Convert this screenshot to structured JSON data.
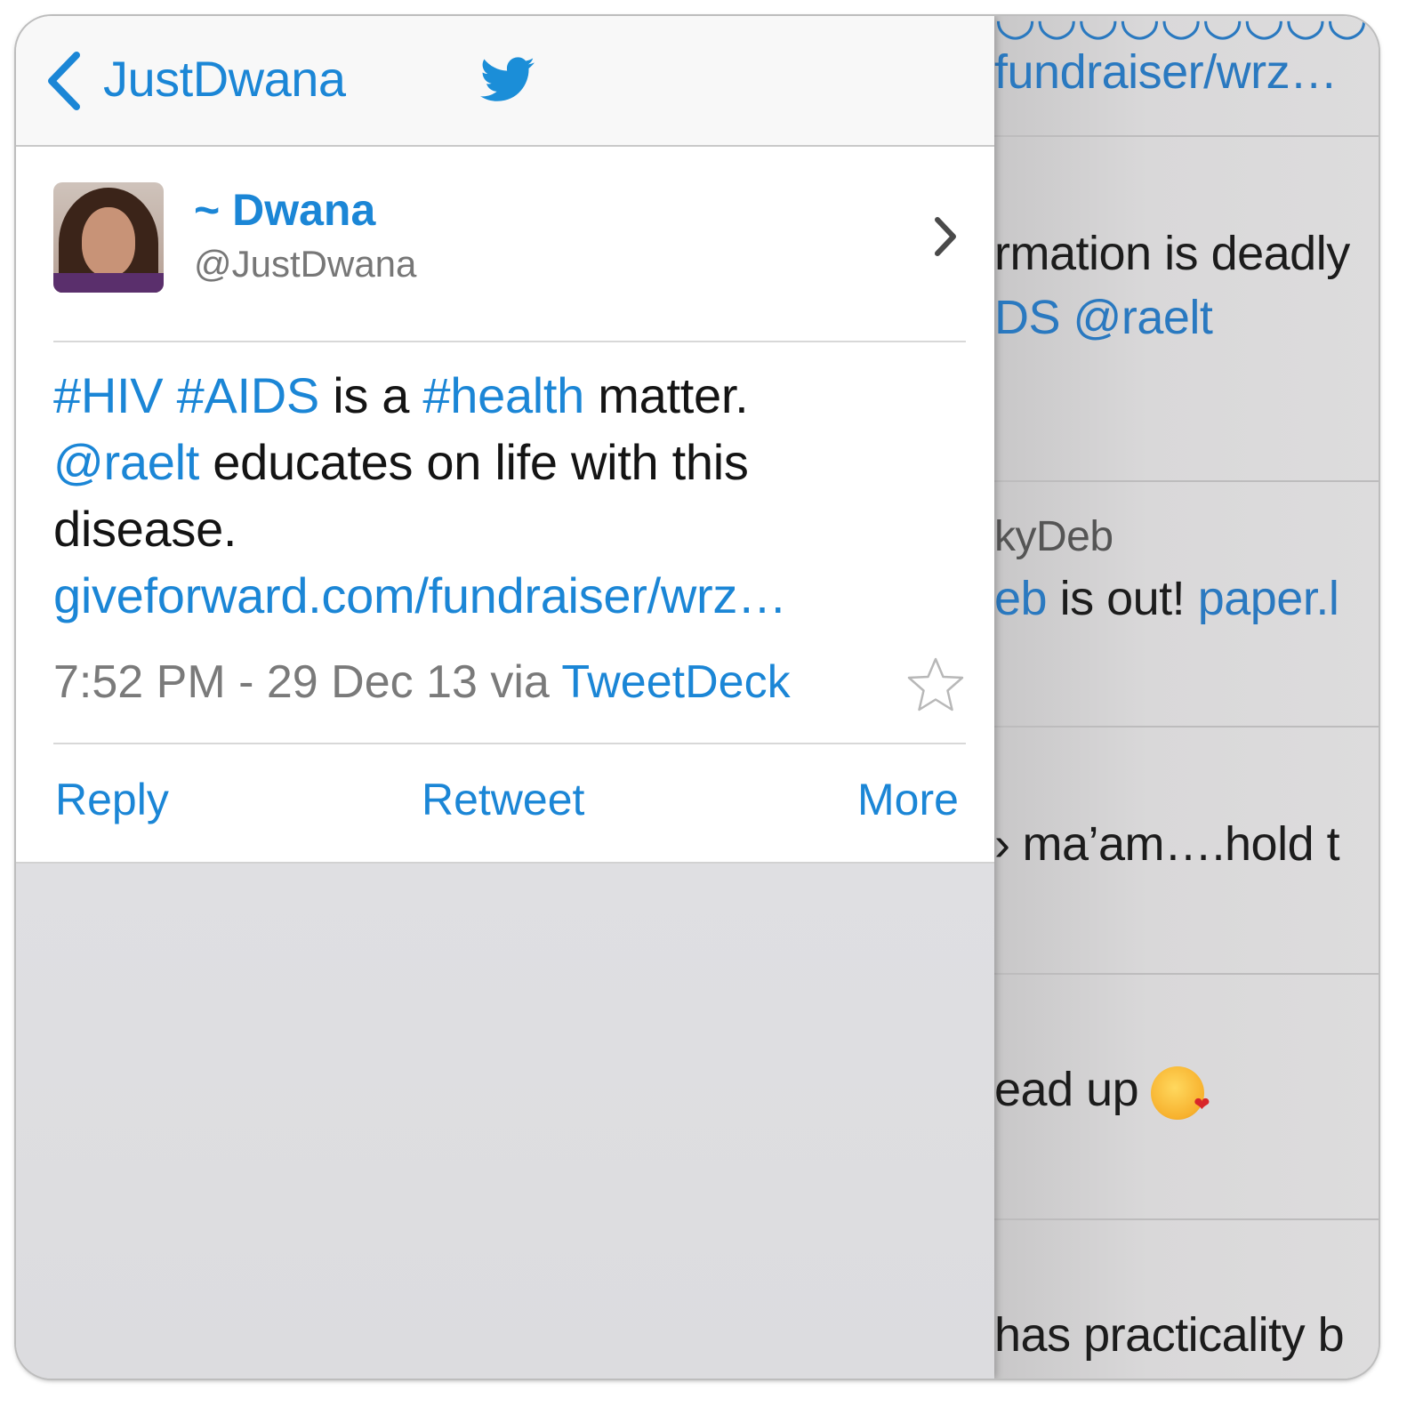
{
  "nav": {
    "back_label": "JustDwana",
    "bird_icon": "twitter-bird-icon"
  },
  "tweet": {
    "display_name": "~ Dwana",
    "handle": "@JustDwana",
    "text_parts": {
      "tag_hiv": "#HIV",
      "tag_aids": "#AIDS",
      "plain1": "is a",
      "tag_health": "#health",
      "plain2": "matter.",
      "mention": "@raelt",
      "plain3": "educates on life with this disease.",
      "link": "giveforward.com/fundraiser/wrz…"
    },
    "time": "7:52 PM - 29 Dec 13 via",
    "client": "TweetDeck"
  },
  "actions": {
    "reply": "Reply",
    "retweet": "Retweet",
    "more": "More"
  },
  "background_timeline": {
    "line1": "fundraiser/wrz…",
    "line2": "rmation is deadly",
    "line3_link": "DS @raelt",
    "line4": "kyDeb",
    "line5_link": "eb",
    "line5": "is out!",
    "line5_link2": "paper.l",
    "line6": "ma’am….hold t",
    "line7": "ead up",
    "line8": "has practicality b"
  },
  "colors": {
    "accent": "#1b86d6",
    "text": "#141414",
    "muted": "#7a7a7a"
  }
}
